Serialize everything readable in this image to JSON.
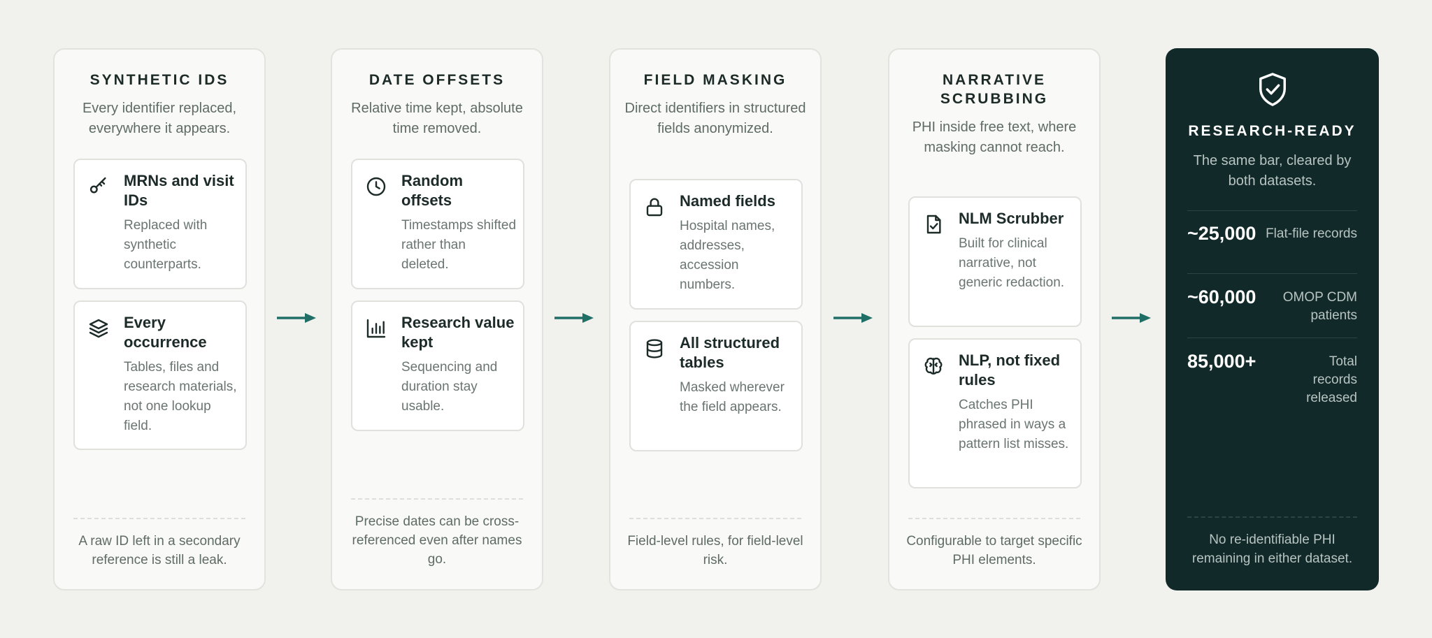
{
  "columns": [
    {
      "title": "SYNTHETIC IDS",
      "subtitle": "Every identifier replaced, everywhere it appears.",
      "cards": [
        {
          "icon": "key-icon",
          "title": "MRNs and visit IDs",
          "desc": "Replaced with synthetic counterparts."
        },
        {
          "icon": "layers-icon",
          "title": "Every occurrence",
          "desc": "Tables, files and research materials, not one lookup field."
        }
      ],
      "footer": "A raw ID left in a secondary reference is still a leak."
    },
    {
      "title": "DATE OFFSETS",
      "subtitle": "Relative time kept, absolute time removed.",
      "cards": [
        {
          "icon": "clock-icon",
          "title": "Random offsets",
          "desc": "Timestamps shifted rather than deleted."
        },
        {
          "icon": "bar-chart-icon",
          "title": "Research value kept",
          "desc": "Sequencing and duration stay usable."
        }
      ],
      "footer": "Precise dates can be cross-referenced even after names go."
    },
    {
      "title": "FIELD MASKING",
      "subtitle": "Direct identifiers in structured fields anonymized.",
      "cards": [
        {
          "icon": "lock-icon",
          "title": "Named fields",
          "desc": "Hospital names, addresses, accession numbers."
        },
        {
          "icon": "database-icon",
          "title": "All structured tables",
          "desc": "Masked wherever the field appears."
        }
      ],
      "footer": "Field-level rules, for field-level risk."
    },
    {
      "title": "NARRATIVE SCRUBBING",
      "subtitle": "PHI inside free text, where masking cannot reach.",
      "cards": [
        {
          "icon": "file-check-icon",
          "title": "NLM Scrubber",
          "desc": "Built for clinical narrative, not generic redaction."
        },
        {
          "icon": "brain-icon",
          "title": "NLP, not fixed rules",
          "desc": "Catches PHI phrased in ways a pattern list misses."
        }
      ],
      "footer": "Configurable to target specific PHI elements."
    }
  ],
  "final": {
    "icon": "shield-check-icon",
    "title": "RESEARCH-READY",
    "subtitle": "The same bar, cleared by both datasets.",
    "stats": [
      {
        "value": "~25,000",
        "label": "Flat-file records"
      },
      {
        "value": "~60,000",
        "label": "OMOP CDM patients"
      },
      {
        "value": "85,000+",
        "label": "Total records released"
      }
    ],
    "footer": "No re-identifiable PHI remaining in either dataset."
  },
  "colors": {
    "accent": "#1f6f66",
    "final_bg": "#12292a",
    "page_bg": "#f1f1ee"
  }
}
